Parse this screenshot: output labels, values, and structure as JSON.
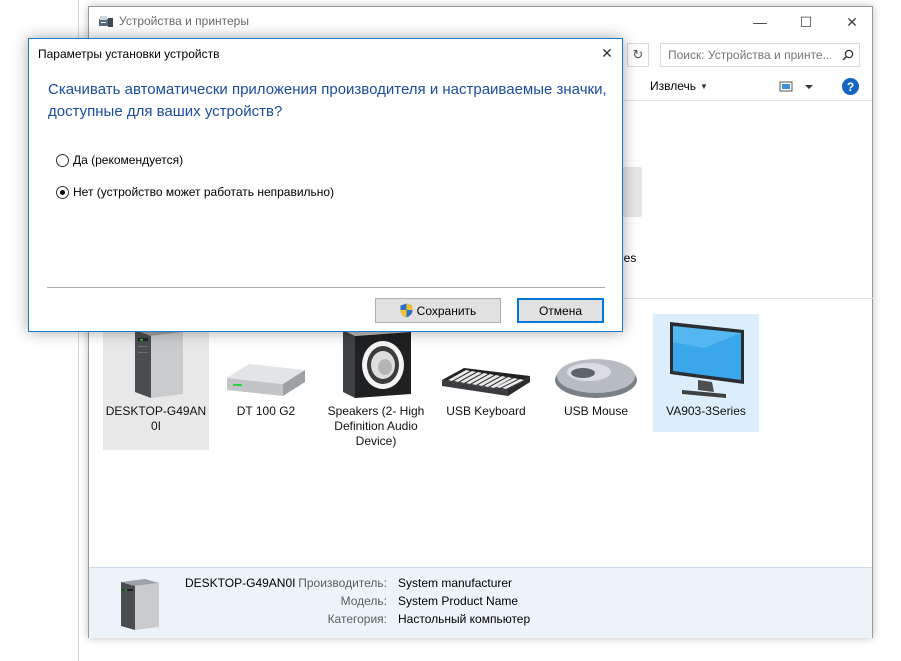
{
  "window": {
    "title": "Устройства и принтеры",
    "minimize_glyph": "—",
    "maximize_glyph": "☐",
    "close_glyph": "✕"
  },
  "address": {
    "search_placeholder": "Поиск: Устройства и принте...",
    "refresh_glyph": "↻"
  },
  "toolbar": {
    "eject_label": "Извлечь",
    "help_label": "?"
  },
  "partial_device": {
    "label_fragment": "ries"
  },
  "devices": [
    {
      "name": "DESKTOP-G49AN0I",
      "label": "DESKTOP-G49AN 0I",
      "icon": "desktop-tower-icon",
      "selected": true
    },
    {
      "name": "DT 100 G2",
      "label": "DT 100 G2",
      "icon": "usb-drive-icon"
    },
    {
      "name": "Speakers (2- High Definition Audio Device)",
      "label": "Speakers (2- High Definition Audio Device)",
      "icon": "speaker-icon"
    },
    {
      "name": "USB Keyboard",
      "label": "USB Keyboard",
      "icon": "keyboard-icon"
    },
    {
      "name": "USB Mouse",
      "label": "USB Mouse",
      "icon": "mouse-icon"
    },
    {
      "name": "VA903-3Series",
      "label": "VA903-3Series",
      "icon": "monitor-icon",
      "highlighted": true
    }
  ],
  "details": {
    "device_name": "DESKTOP-G49AN0I",
    "manufacturer_key": "Производитель:",
    "manufacturer_value": "System manufacturer",
    "model_key": "Модель:",
    "model_value": "System Product Name",
    "category_key": "Категория:",
    "category_value": "Настольный компьютер"
  },
  "dialog": {
    "title": "Параметры установки устройств",
    "close_glyph": "✕",
    "question": "Скачивать автоматически приложения производителя и настраиваемые значки, доступные для ваших устройств?",
    "options": [
      {
        "label": "Да (рекомендуется)",
        "checked": false
      },
      {
        "label": "Нет (устройство может работать неправильно)",
        "checked": true
      }
    ],
    "save_label": "Сохранить",
    "cancel_label": "Отмена"
  },
  "colors": {
    "accent": "#0078d7",
    "question_text": "#1a4da1",
    "details_bg": "#ecf3fb",
    "selection_blue": "#dceefc"
  }
}
